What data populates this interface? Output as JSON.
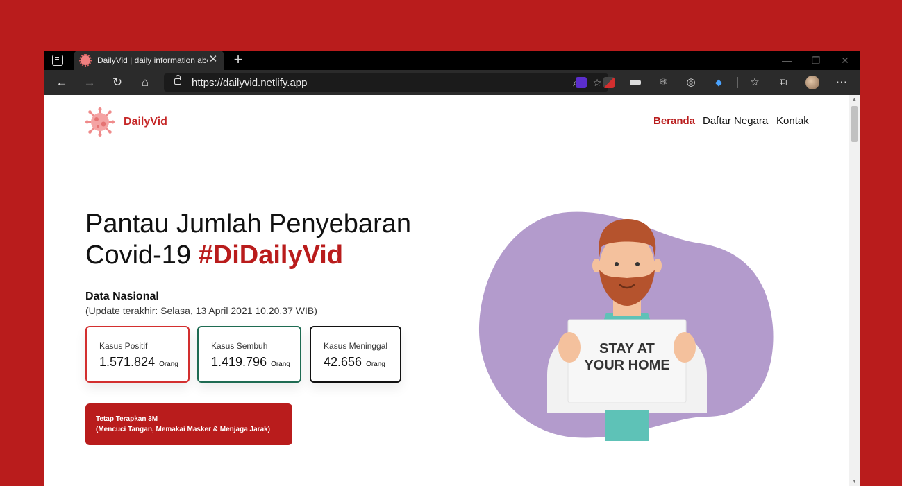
{
  "browser": {
    "tab_title": "DailyVid | daily information about",
    "tab_close": "✕",
    "new_tab": "+",
    "url": "https://dailyvid.netlify.app",
    "window_controls": {
      "minimize": "—",
      "restore": "❐",
      "close": "✕"
    }
  },
  "site": {
    "brand": "DailyVid",
    "nav": [
      {
        "label": "Beranda",
        "active": true
      },
      {
        "label": "Daftar Negara",
        "active": false
      },
      {
        "label": "Kontak",
        "active": false
      }
    ]
  },
  "hero": {
    "title_line1": "Pantau Jumlah Penyebaran",
    "title_line2_prefix": "Covid-19 ",
    "title_line2_accent": "#DiDailyVid"
  },
  "data": {
    "heading": "Data Nasional",
    "update": "(Update terakhir: Selasa, 13 April 2021 10.20.37 WIB)",
    "cards": [
      {
        "label": "Kasus Positif",
        "value": "1.571.824",
        "unit": "Orang",
        "color": "#d32f2f"
      },
      {
        "label": "Kasus Sembuh",
        "value": "1.419.796",
        "unit": "Orang",
        "color": "#1e6b52"
      },
      {
        "label": "Kasus Meninggal",
        "value": "42.656",
        "unit": "Orang",
        "color": "#111111"
      }
    ]
  },
  "cta": {
    "line1": "Tetap Terapkan 3M",
    "line2": "(Mencuci Tangan, Memakai Masker & Menjaga Jarak)"
  },
  "illustration": {
    "sign_line1": "STAY AT",
    "sign_line2": "YOUR HOME"
  },
  "colors": {
    "accent": "#b91c1c",
    "blob": "#b39bcc"
  }
}
